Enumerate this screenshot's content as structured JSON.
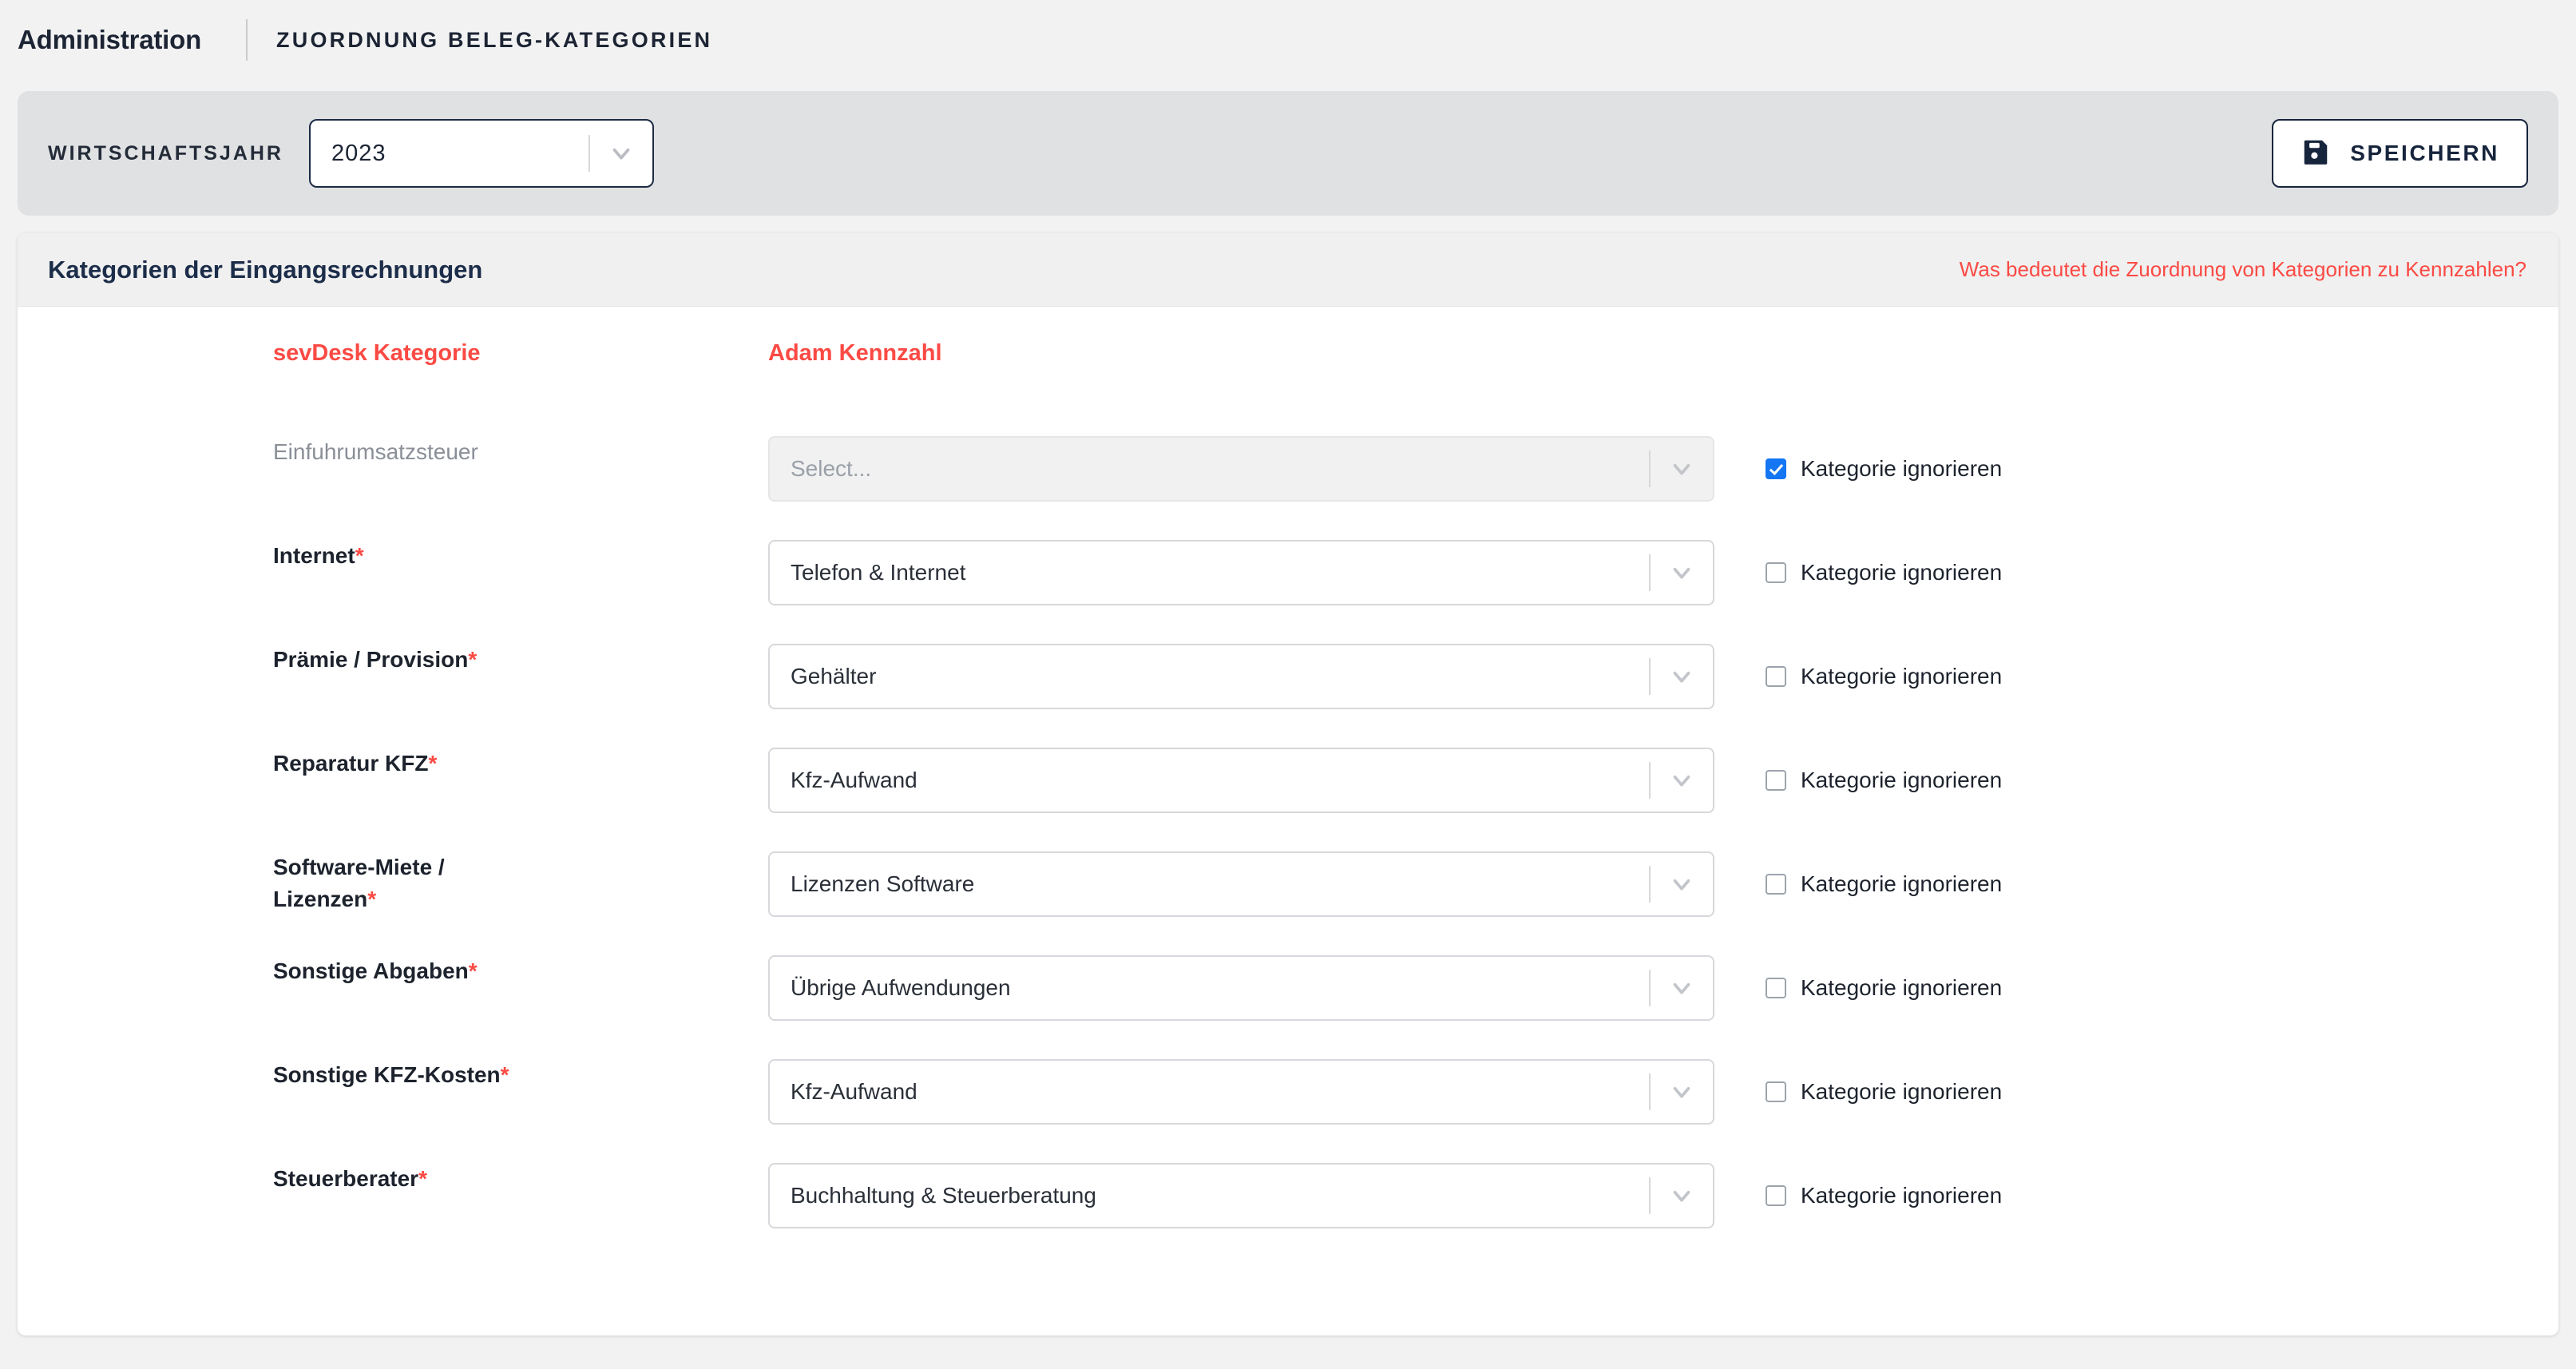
{
  "colors": {
    "accent_red": "#fb4a44",
    "navy": "#1c2d4a",
    "checkbox_blue": "#1476f2",
    "page_bg": "#f2f2f2",
    "toolbar_bg": "#e0e1e3"
  },
  "topbar": {
    "title": "Administration",
    "subtitle": "ZUORDNUNG BELEG-KATEGORIEN"
  },
  "toolbar": {
    "year_label": "WIRTSCHAFTSJAHR",
    "year_value": "2023",
    "save_label": "SPEICHERN"
  },
  "card": {
    "title": "Kategorien der Eingangsrechnungen",
    "help_link": "Was bedeutet die Zuordnung von Kategorien zu Kennzahlen?",
    "columns": {
      "category": "sevDesk Kategorie",
      "kennzahl": "Adam Kennzahl"
    },
    "checkbox_label": "Kategorie ignorieren",
    "select_placeholder": "Select...",
    "rows": [
      {
        "label": "Einfuhrumsatzsteuer",
        "required": false,
        "disabled": true,
        "value": "Select...",
        "ignored": true
      },
      {
        "label": "Internet",
        "required": true,
        "disabled": false,
        "value": "Telefon & Internet",
        "ignored": false
      },
      {
        "label": "Prämie / Provision",
        "required": true,
        "disabled": false,
        "value": "Gehälter",
        "ignored": false
      },
      {
        "label": "Reparatur KFZ",
        "required": true,
        "disabled": false,
        "value": "Kfz-Aufwand",
        "ignored": false
      },
      {
        "label": "Software-Miete / Lizenzen",
        "required": true,
        "disabled": false,
        "value": "Lizenzen Software",
        "ignored": false
      },
      {
        "label": "Sonstige Abgaben",
        "required": true,
        "disabled": false,
        "value": "Übrige Aufwendungen",
        "ignored": false
      },
      {
        "label": "Sonstige KFZ-Kosten",
        "required": true,
        "disabled": false,
        "value": "Kfz-Aufwand",
        "ignored": false
      },
      {
        "label": "Steuerberater",
        "required": true,
        "disabled": false,
        "value": "Buchhaltung & Steuerberatung",
        "ignored": false
      }
    ]
  },
  "icons": {
    "save": "floppy-disk-icon",
    "dropdown": "chevron-down-icon"
  }
}
